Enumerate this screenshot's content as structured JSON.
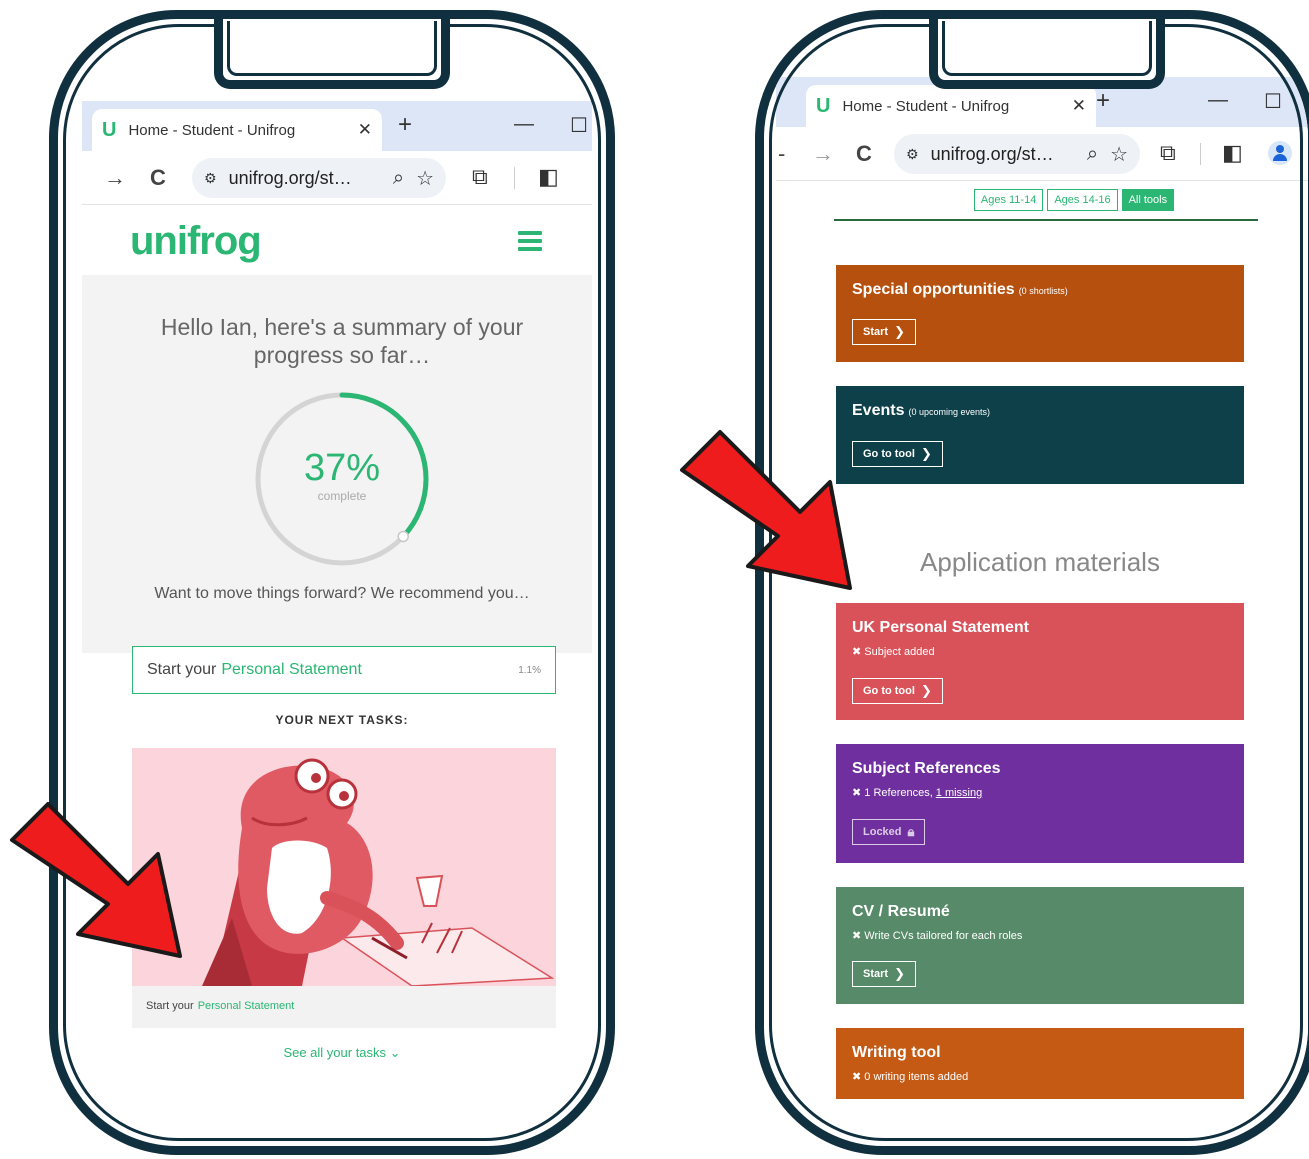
{
  "left_phone": {
    "browser": {
      "tab_title": "Home - Student - Unifrog",
      "tab_close": "✕",
      "new_tab": "+",
      "minimize": "—",
      "restore": "☐",
      "url": "unifrog.org/st…",
      "nav_forward": "→",
      "nav_reload": "C"
    },
    "logo": "unifrog",
    "greeting": "Hello Ian, here's a summary of your progress so far…",
    "progress": {
      "percent_label": "37%",
      "percent_value": 37,
      "sublabel": "complete",
      "accent": "#2bb673"
    },
    "recommend": "Want to move things forward? We recommend you…",
    "recommended_task": {
      "prefix": "Start your",
      "link": "Personal Statement",
      "pct": "1.1%"
    },
    "next_tasks_heading": "YOUR NEXT TASKS:",
    "task_card": {
      "caption_prefix": "Start your",
      "caption_link": "Personal Statement"
    },
    "see_all": "See all your tasks ⌄"
  },
  "right_phone": {
    "browser": {
      "tab_title": "Home - Student - Unifrog",
      "tab_close": "✕",
      "new_tab": "+",
      "minimize": "—",
      "restore": "☐",
      "url": "unifrog.org/st…",
      "nav_back": "-",
      "nav_forward": "→",
      "nav_reload": "C"
    },
    "filters": [
      "Ages 11-14",
      "Ages 14-16",
      "All tools"
    ],
    "active_filter": "All tools",
    "cards_top": [
      {
        "title": "Special opportunities",
        "note": "(0 shortlists)",
        "button": "Start",
        "color": "#b5500f"
      },
      {
        "title": "Events",
        "note": "(0 upcoming events)",
        "button": "Go to tool",
        "color": "#0d4049"
      }
    ],
    "section_title": "Application materials",
    "cards_app": [
      {
        "title": "UK Personal Statement",
        "status": "Subject added",
        "status_link": "",
        "button": "Go to tool",
        "color": "#d9525a"
      },
      {
        "title": "Subject References",
        "status": "1 References,",
        "status_link": "1 missing",
        "button": "Locked",
        "color": "#6f2f9e"
      },
      {
        "title": "CV / Resumé",
        "status": "Write CVs tailored for each roles",
        "status_link": "",
        "button": "Start",
        "color": "#578a68"
      },
      {
        "title": "Writing tool",
        "status": "0 writing items added",
        "status_link": "",
        "button": "",
        "color": "#c45a14"
      }
    ]
  },
  "arrow_color": "#ee1c1c"
}
